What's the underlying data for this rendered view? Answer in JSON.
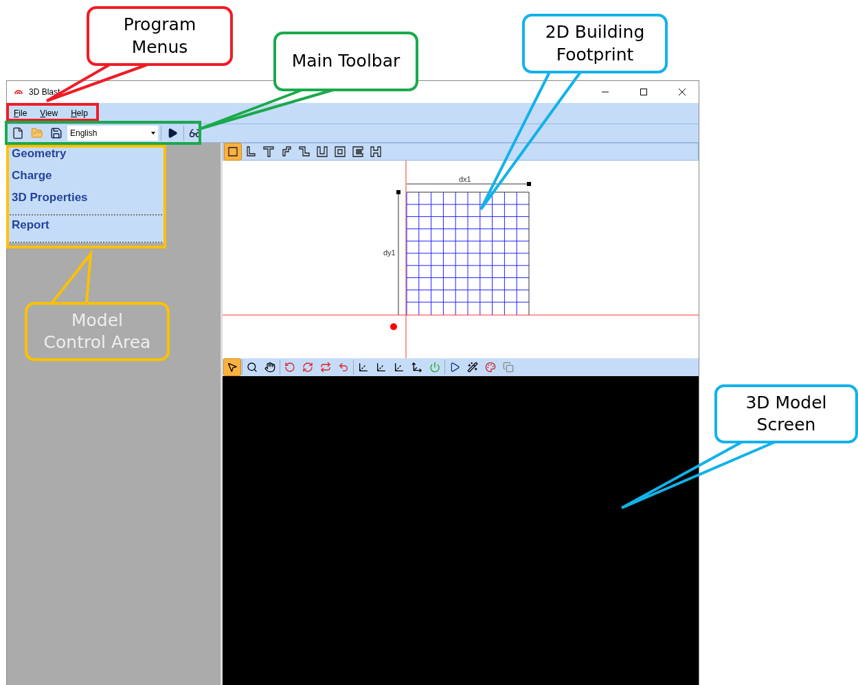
{
  "window": {
    "title": "3D Blast"
  },
  "menu": [
    "File",
    "View",
    "Help"
  ],
  "toolbar": {
    "language": "English"
  },
  "sidebar": {
    "sections": [
      {
        "items": [
          "Geometry",
          "Charge",
          "3D Properties"
        ]
      },
      {
        "items": [
          "Report"
        ]
      }
    ]
  },
  "shape_tools": [
    {
      "selected": true
    },
    {
      "selected": false
    },
    {
      "selected": false
    },
    {
      "selected": false
    },
    {
      "selected": false
    },
    {
      "selected": false
    },
    {
      "selected": false
    },
    {
      "selected": false
    },
    {
      "selected": false
    }
  ],
  "footprint": {
    "dx_label": "dx1",
    "dy_label": "dy1"
  },
  "view_tools": [
    {
      "selected": true
    },
    {
      "selected": false
    },
    {
      "selected": false
    },
    {
      "selected": false
    },
    {
      "selected": false
    },
    {
      "selected": false
    },
    {
      "selected": false
    },
    {
      "selected": false
    },
    {
      "selected": false
    },
    {
      "selected": false
    },
    {
      "selected": false
    },
    {
      "selected": false
    },
    {
      "selected": false
    },
    {
      "selected": false
    },
    {
      "selected": false
    },
    {
      "selected": false
    }
  ],
  "callouts": [
    {
      "text": "Program\nMenus",
      "color": "#ee1c25"
    },
    {
      "text": "Main Toolbar",
      "color": "#1aa94b"
    },
    {
      "text": "2D Building\nFootprint",
      "color": "#12b2ea"
    },
    {
      "text": "Model\nControl Area",
      "color": "#ffc000"
    },
    {
      "text": "3D Model\nScreen",
      "color": "#12b2ea"
    }
  ]
}
